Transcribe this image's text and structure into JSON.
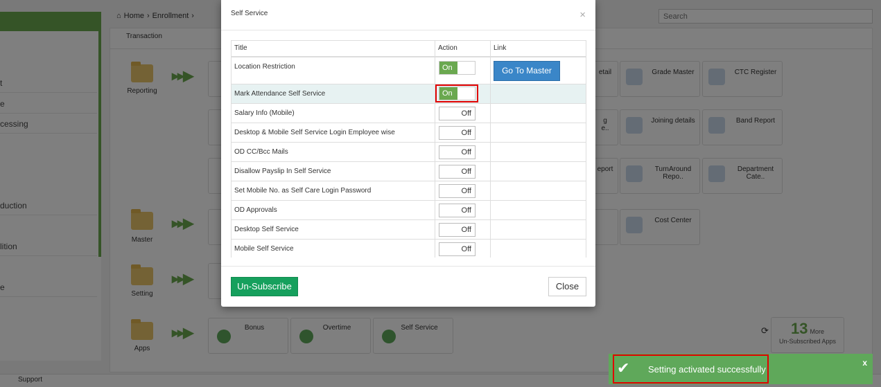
{
  "breadcrumb": {
    "home": "Home",
    "sep": "›",
    "current": "Enrollment",
    "sep2": "›"
  },
  "search": {
    "placeholder": "Search"
  },
  "background": {
    "tab_label": "Transaction",
    "sidebar_items": [
      "t",
      "e",
      "cessing",
      "duction",
      "lition",
      "e"
    ],
    "sections": [
      {
        "label": "Reporting"
      },
      {
        "label": "Master"
      },
      {
        "label": "Setting"
      },
      {
        "label": "Apps"
      }
    ],
    "cards": [
      {
        "label": "etail"
      },
      {
        "label": "Grade Master"
      },
      {
        "label": "CTC Register"
      },
      {
        "label": "g\ne.."
      },
      {
        "label": "Joining details"
      },
      {
        "label": "Band Report"
      },
      {
        "label": "eport"
      },
      {
        "label": "TurnAround\nRepo.."
      },
      {
        "label": "Department\nCate.."
      },
      {
        "label": "Cost Center"
      }
    ],
    "app_cards": [
      "Bonus",
      "Overtime",
      "Self Service"
    ],
    "more": {
      "count": "13",
      "more_label": "More",
      "caption": "Un-Subscribed Apps"
    },
    "footer_text": "Support"
  },
  "modal": {
    "title": "Self Service",
    "close_symbol": "×",
    "columns": {
      "title": "Title",
      "action": "Action",
      "link": "Link"
    },
    "rows": [
      {
        "title": "Location Restriction",
        "state": "On",
        "link": "Go To Master"
      },
      {
        "title": "Mark Attendance Self Service",
        "state": "On",
        "link": ""
      },
      {
        "title": "Salary Info (Mobile)",
        "state": "Off",
        "link": ""
      },
      {
        "title": "Desktop & Mobile Self Service Login Employee wise",
        "state": "Off",
        "link": ""
      },
      {
        "title": "OD CC/Bcc Mails",
        "state": "Off",
        "link": ""
      },
      {
        "title": "Disallow Payslip In Self Service",
        "state": "Off",
        "link": ""
      },
      {
        "title": "Set Mobile No. as Self Care Login Password",
        "state": "Off",
        "link": ""
      },
      {
        "title": "OD Approvals",
        "state": "Off",
        "link": ""
      },
      {
        "title": "Desktop Self Service",
        "state": "Off",
        "link": ""
      },
      {
        "title": "Mobile Self Service",
        "state": "Off",
        "link": ""
      }
    ],
    "unsubscribe_label": "Un-Subscribe",
    "close_label": "Close"
  },
  "toast": {
    "message": "Setting activated successfully",
    "close_symbol": "x"
  },
  "colors": {
    "accent": "#6aa84f",
    "button_blue": "#3a86c8",
    "unsubscribe": "#16a05d",
    "highlight": "#e00000"
  }
}
